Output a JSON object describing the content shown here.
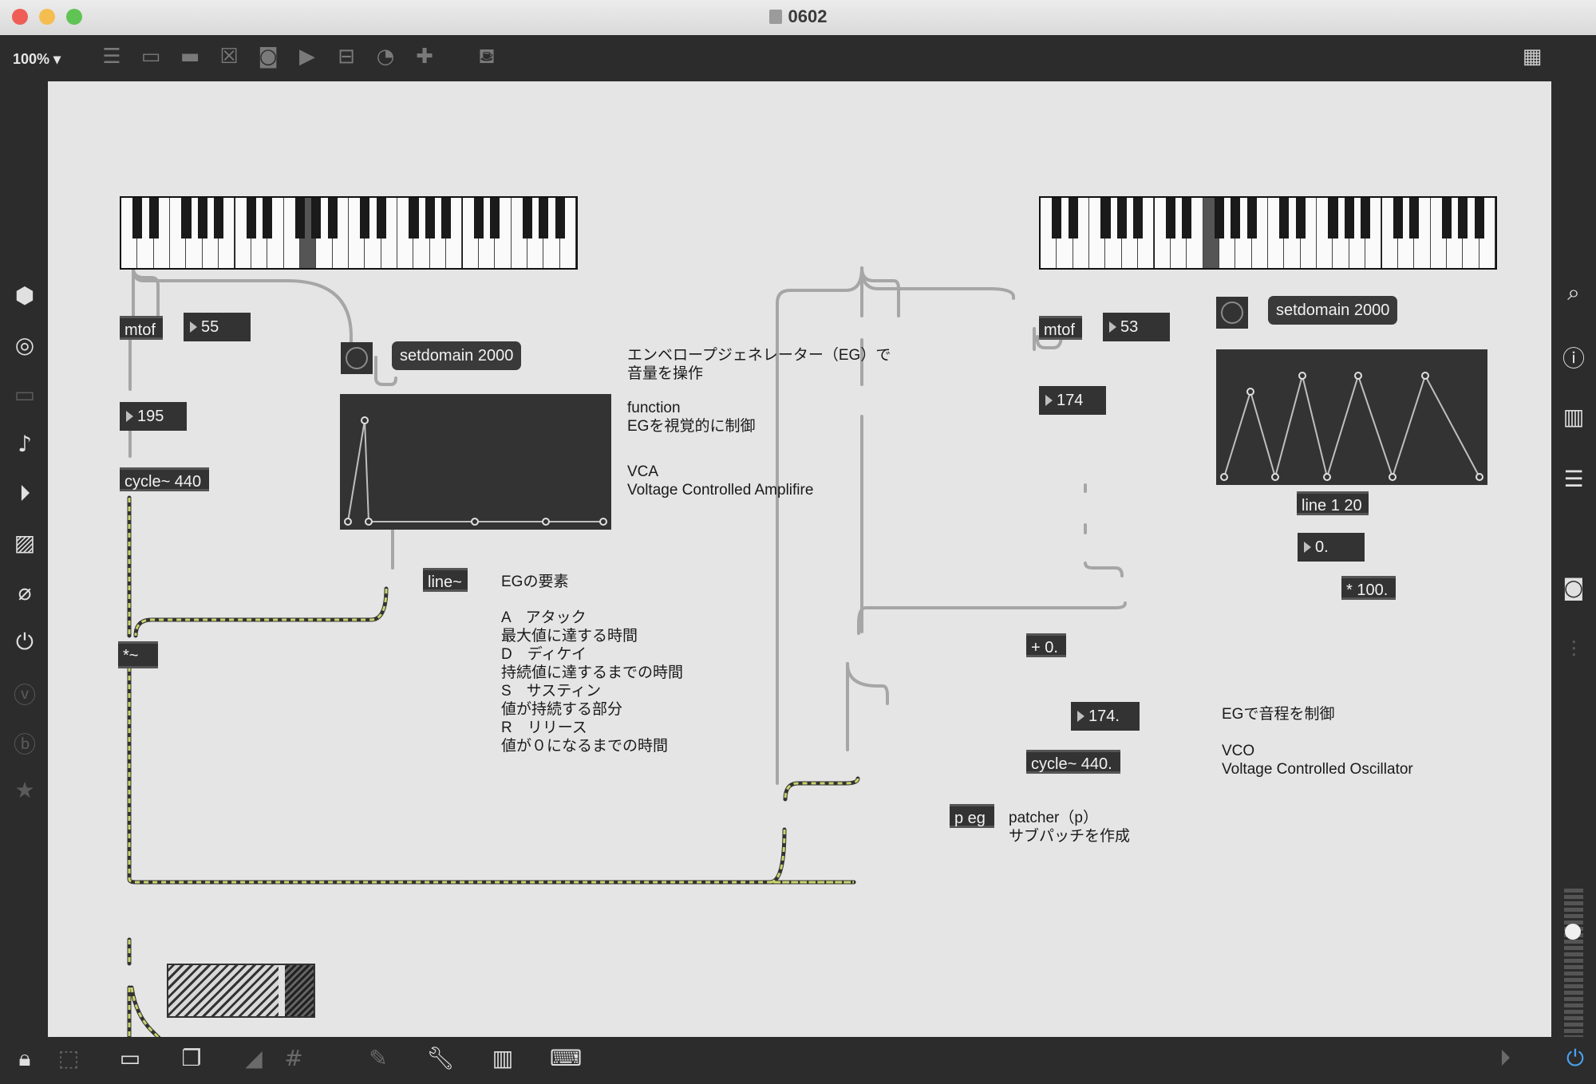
{
  "window": {
    "title": "0602",
    "zoom": "100%"
  },
  "toolbar_icons": [
    "presentation-icon",
    "message-icon",
    "comment-icon",
    "toggle-icon",
    "button-icon",
    "playbar-icon",
    "slider-icon",
    "dial-icon",
    "plus-icon",
    "paint-bucket-icon",
    "grid-icon"
  ],
  "left_sidebar_icons": [
    "package-icon",
    "target-icon",
    "device-icon",
    "note-icon",
    "media-icon",
    "image-icon",
    "clip-icon",
    "plugin-icon",
    "v-icon",
    "b-icon",
    "star-icon"
  ],
  "right_sidebar_icons": [
    "search-icon",
    "info-icon",
    "book-icon",
    "list-icon",
    "camera-icon",
    "mixer-icon"
  ],
  "bottom_icons": [
    "lock-icon",
    "select-icon",
    "presentation-mode-icon",
    "windows-icon",
    "debug-icon",
    "grid-icon",
    "pin-icon",
    "wrench-icon",
    "piano-icon",
    "keyboard-icon",
    "play-circle-icon",
    "power-icon"
  ],
  "left_patch": {
    "mtof": "mtof",
    "note_number": "55",
    "freq_number": "195",
    "cycle": "cycle~ 440",
    "setdomain": "setdomain 2000",
    "line": "line~",
    "mult": "*~"
  },
  "right_patch": {
    "mtof": "mtof",
    "note_number": "53",
    "freq_number": "174",
    "setdomain": "setdomain 2000",
    "line": "line 1 20",
    "float_number": "0.",
    "mult100": "* 100.",
    "plus": "+ 0.",
    "sum_number": "174.",
    "cycle": "cycle~ 440.",
    "patcher": "p eg"
  },
  "comments": {
    "eg_title_1": "エンベロープジェネレーター（EG）で",
    "eg_title_2": "音量を操作",
    "function_1": "function",
    "function_2": "EGを視覚的に制御",
    "vca_1": "VCA",
    "vca_2": "Voltage Controlled Amplifire",
    "eg_elements": "EGの要素",
    "a_1": "A　アタック",
    "a_2": "最大値に達する時間",
    "d_1": "D　ディケイ",
    "d_2": "持続値に達するまでの時間",
    "s_1": "S　サスティン",
    "s_2": "値が持続する部分",
    "r_1": "R　リリース",
    "r_2": "値が０になるまでの時間",
    "pitch_1": "EGで音程を制御",
    "vco_1": "VCO",
    "vco_2": "Voltage Controlled Oscillator",
    "patcher_1": "patcher（p）",
    "patcher_2": "サブパッチを作成"
  },
  "colors": {
    "canvas": "#e5e5e5",
    "object": "#333333",
    "signal_wire": "#c9d36a",
    "wire": "#a6a6a6",
    "close": "#ee5e56",
    "minimize": "#f5bd4f",
    "zoom": "#5fc454"
  }
}
